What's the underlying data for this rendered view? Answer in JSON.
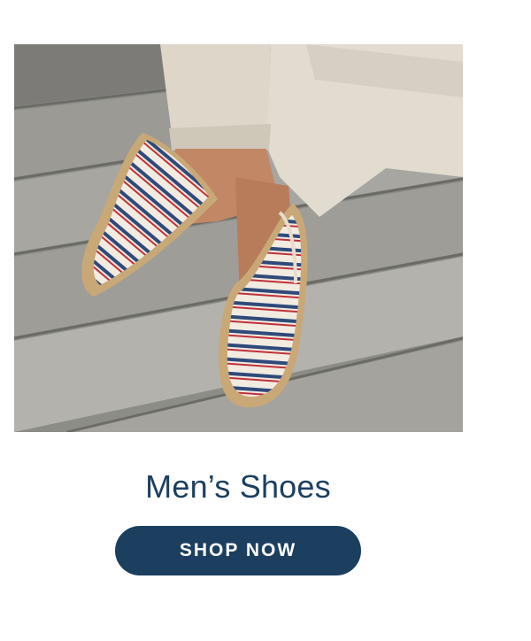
{
  "promo": {
    "image": {
      "alt": "Legs in beige linen trousers wearing striped espadrilles on a weathered wooden deck",
      "stripe_colors": [
        "#2f4a7a",
        "#c0303a",
        "#f1ebe0"
      ]
    },
    "title": "Men’s Shoes",
    "cta_label": "SHOP NOW",
    "colors": {
      "brand": "#1c3f60",
      "background": "#ffffff",
      "button_text": "#ffffff"
    }
  }
}
